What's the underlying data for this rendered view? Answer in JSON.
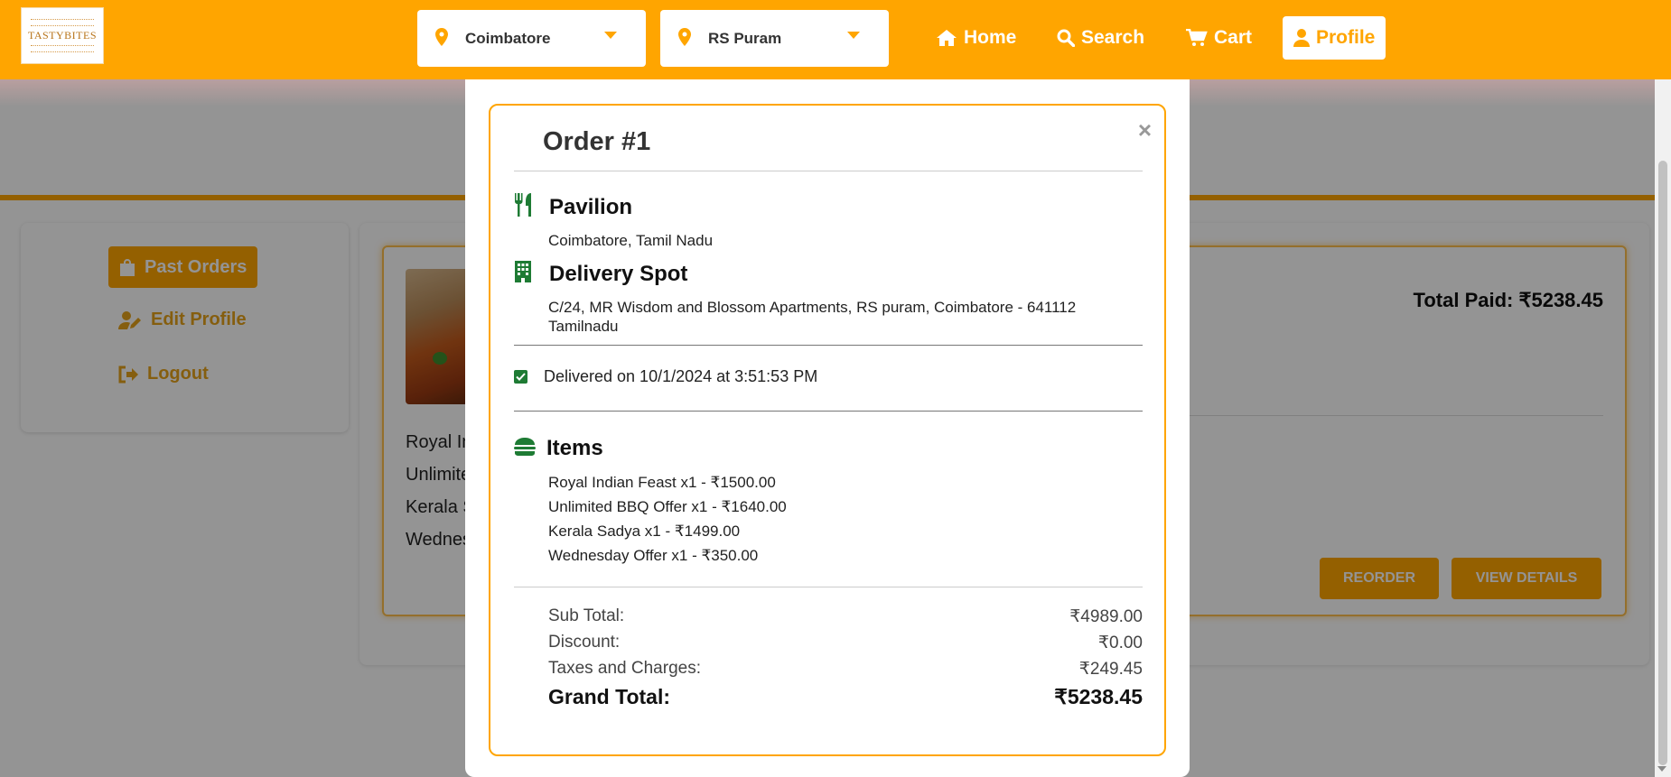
{
  "header": {
    "logo_text": "TASTYBITES",
    "city": "Coimbatore",
    "area": "RS Puram",
    "nav": {
      "home": "Home",
      "search": "Search",
      "cart": "Cart",
      "profile": "Profile"
    }
  },
  "sidebar": {
    "past_orders": "Past Orders",
    "edit_profile": "Edit Profile",
    "logout": "Logout"
  },
  "order_card": {
    "items_partial": [
      "Royal In",
      "Unlimite",
      "Kerala S",
      "Wednes"
    ],
    "total_paid": "Total Paid: ₹5238.45",
    "reorder": "REORDER",
    "view_details": "VIEW DETAILS"
  },
  "modal": {
    "title": "Order #1",
    "close": "×",
    "restaurant_title": "Pavilion",
    "restaurant_location": "Coimbatore, Tamil Nadu",
    "delivery_title": "Delivery Spot",
    "delivery_address_line1": "C/24, MR Wisdom and Blossom Apartments, RS puram, Coimbatore - 641112",
    "delivery_address_line2": "Tamilnadu",
    "delivered_text": "Delivered on 10/1/2024 at 3:51:53 PM",
    "items_title": "Items",
    "items": [
      "Royal Indian Feast x1 - ₹1500.00",
      "Unlimited BBQ Offer x1 - ₹1640.00",
      "Kerala Sadya x1 - ₹1499.00",
      "Wednesday Offer x1 - ₹350.00"
    ],
    "summary": {
      "subtotal_label": "Sub Total:",
      "subtotal_value": "₹4989.00",
      "discount_label": "Discount:",
      "discount_value": "₹0.00",
      "taxes_label": "Taxes and Charges:",
      "taxes_value": "₹249.45",
      "grand_label": "Grand Total:",
      "grand_value": "₹5238.45"
    }
  },
  "colors": {
    "brand_orange": "#ffa500",
    "accent_green": "#1e7b34"
  },
  "icons": {
    "location": "map-pin-icon",
    "dropdown": "caret-down-icon",
    "home": "home-icon",
    "search": "search-icon",
    "cart": "cart-icon",
    "profile": "user-icon",
    "past_orders": "shopping-bag-icon",
    "edit_profile": "user-edit-icon",
    "logout": "sign-out-icon",
    "restaurant": "utensils-icon",
    "delivery": "building-icon",
    "delivered": "check-square-icon",
    "items": "burger-icon"
  }
}
